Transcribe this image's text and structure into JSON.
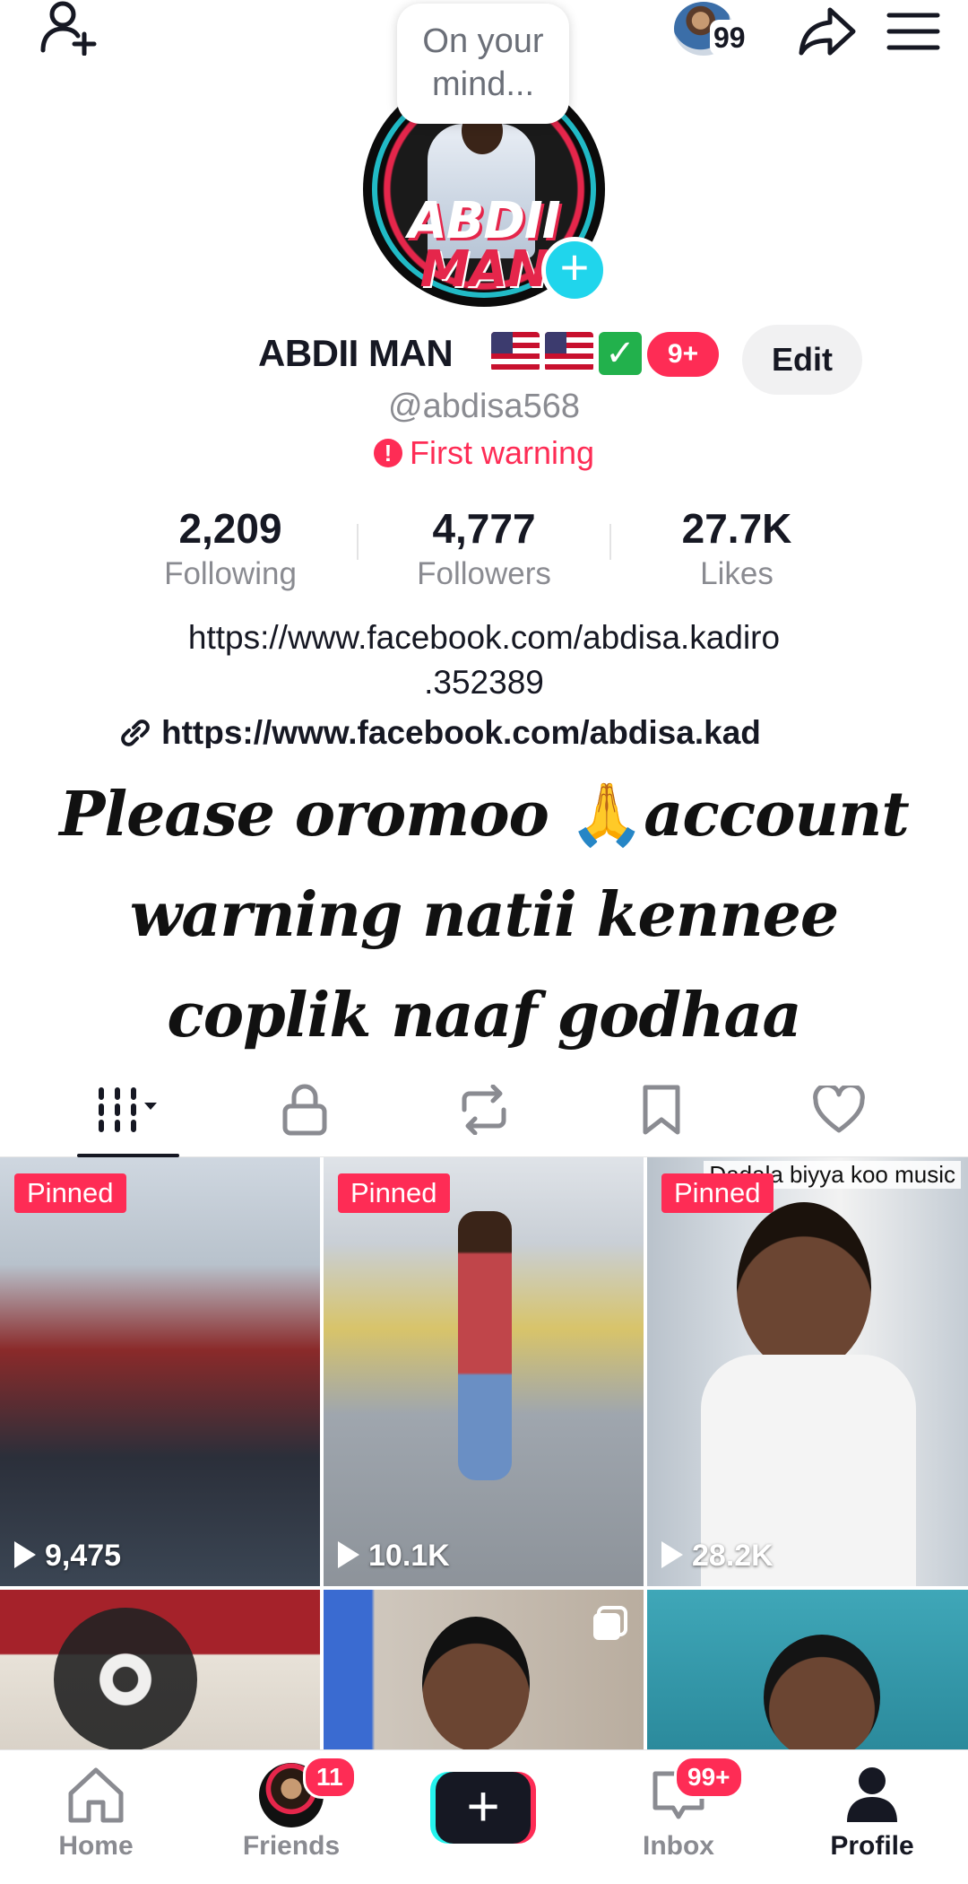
{
  "topbar": {
    "add_friend_icon": "add-user-icon",
    "mini_avatar_count": "99",
    "share_icon": "share-arrow-icon",
    "menu_icon": "hamburger-menu-icon"
  },
  "profile": {
    "bubble_text": "On your mind...",
    "avatar_logo_line1": "ABDII",
    "avatar_logo_line2": "MAN",
    "add_story_icon": "plus-icon",
    "display_name": "ABDII MAN",
    "verified_icon": "check-box-icon",
    "notification_count": "9+",
    "edit_label": "Edit",
    "handle": "@abdisa568",
    "warning_text": "First warning",
    "warning_icon": "exclamation-icon"
  },
  "stats": [
    {
      "value": "2,209",
      "label": "Following"
    },
    {
      "value": "4,777",
      "label": "Followers"
    },
    {
      "value": "27.7K",
      "label": "Likes"
    }
  ],
  "bio": {
    "line1": "https://www.facebook.com/abdisa.kadiro",
    "line2": ".352389",
    "link_text": "https://www.facebook.com/abdisa.kad"
  },
  "overlay": {
    "line1": "Please oromoo",
    "emoji": "🙏",
    "line1b": "account",
    "line2": "warning natii kennee",
    "line3": "coplik naaf godhaa"
  },
  "tabs": [
    {
      "icon": "grid-icon",
      "active": true
    },
    {
      "icon": "lock-icon",
      "active": false
    },
    {
      "icon": "repost-icon",
      "active": false
    },
    {
      "icon": "bookmark-icon",
      "active": false
    },
    {
      "icon": "heart-icon",
      "active": false
    }
  ],
  "videos": [
    {
      "pinned": "Pinned",
      "views": "9,475"
    },
    {
      "pinned": "Pinned",
      "views": "10.1K"
    },
    {
      "pinned": "Pinned",
      "views": "28.2K",
      "caption": "Dadala biyya koo music"
    },
    {
      "pinned": "",
      "views": ""
    },
    {
      "pinned": "",
      "views": ""
    },
    {
      "pinned": "",
      "views": ""
    }
  ],
  "nav": {
    "home": "Home",
    "friends": "Friends",
    "friends_badge": "11",
    "create_icon": "plus-icon",
    "inbox": "Inbox",
    "inbox_badge": "99+",
    "profile": "Profile"
  },
  "colors": {
    "accent_red": "#fe2c55",
    "accent_cyan": "#25f4ee",
    "text_primary": "#161823",
    "text_secondary": "#8a8b91"
  }
}
